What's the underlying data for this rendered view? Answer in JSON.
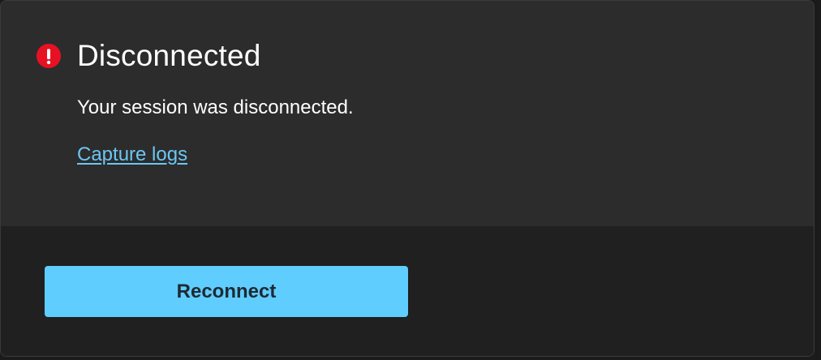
{
  "dialog": {
    "title": "Disconnected",
    "message": "Your session was disconnected.",
    "link_text": "Capture logs",
    "status_icon": "error-icon",
    "colors": {
      "error": "#e81123",
      "link": "#6cc6f3",
      "accent": "#60cdff"
    }
  },
  "footer": {
    "reconnect_label": "Reconnect"
  }
}
